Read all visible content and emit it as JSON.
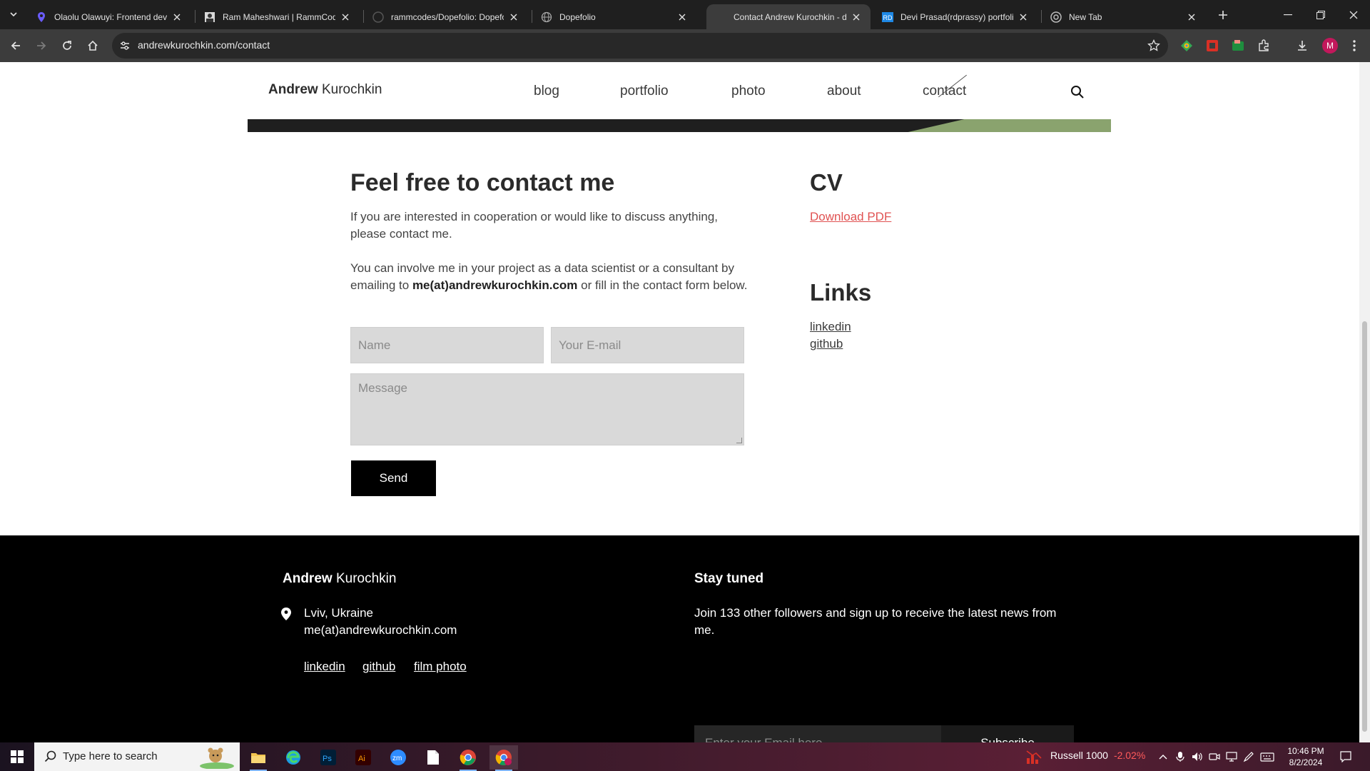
{
  "browser": {
    "tabs": [
      {
        "title": "Olaolu Olawuyi: Frontend deve",
        "icon": "map-pin-icon"
      },
      {
        "title": "Ram Maheshwari | RammCodes",
        "icon": "profile-icon"
      },
      {
        "title": "rammcodes/Dopefolio: Dopefo",
        "icon": "github-icon"
      },
      {
        "title": "Dopefolio",
        "icon": "globe-icon"
      },
      {
        "title": "Contact Andrew Kurochkin - da",
        "icon": "blank-icon"
      },
      {
        "title": "Devi Prasad(rdprassy) portfolio",
        "icon": "rd-logo-icon"
      },
      {
        "title": "New Tab",
        "icon": "chrome-icon"
      }
    ],
    "active_tab_index": 4,
    "url": "andrewkurochkin.com/contact",
    "profile_initial": "M"
  },
  "site": {
    "brand_first": "Andrew",
    "brand_last": "Kurochkin",
    "nav": {
      "blog": "blog",
      "portfolio": "portfolio",
      "photo": "photo",
      "about": "about",
      "contact": "contact"
    },
    "accent_green": "#8aa36e"
  },
  "contact": {
    "heading": "Feel free to contact me",
    "intro": "If you are interested in cooperation or would like to discuss anything, please contact me.",
    "involve_pre": "You can involve me in your project as a data scientist or a consultant by emailing to ",
    "email": "me(at)andrewkurochkin.com",
    "involve_post": " or fill in the contact form below.",
    "name_placeholder": "Name",
    "email_placeholder": "Your E-mail",
    "message_placeholder": "Message",
    "send_label": "Send"
  },
  "sidebar": {
    "cv_heading": "CV",
    "cv_link": "Download PDF",
    "cv_link_color": "#e05252",
    "links_heading": "Links",
    "linkedin": "linkedin",
    "github": "github"
  },
  "footer": {
    "brand_first": "Andrew",
    "brand_last": "Kurochkin",
    "location": "Lviv, Ukraine",
    "email": "me(at)andrewkurochkin.com",
    "links": {
      "linkedin": "linkedin",
      "github": "github",
      "film": "film photo"
    },
    "stay_title": "Stay tuned",
    "stay_text": "Join 133 other followers and sign up to receive the latest news from me.",
    "email_placeholder": "Enter your Email here",
    "subscribe_label": "Subscribe"
  },
  "taskbar": {
    "search_placeholder": "Type here to search",
    "ticker_name": "Russell 1000",
    "ticker_change": "-2.02%",
    "time": "10:46 PM",
    "date": "8/2/2024"
  }
}
